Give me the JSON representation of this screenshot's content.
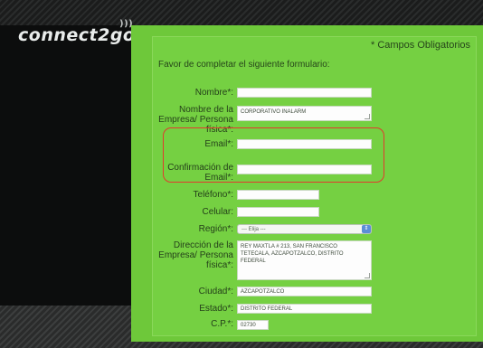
{
  "brand": {
    "logo": "connect2go"
  },
  "form": {
    "required_note": "* Campos Obligatorios",
    "intro": "Favor de completar el siguiente formulario:",
    "nombre_label": "Nombre*:",
    "nombre_value": "",
    "empresa_label": "Nombre de la Empresa/ Persona física*:",
    "empresa_value": "CORPORATIVO INALARM",
    "email_label": "Email*:",
    "email_value": "",
    "confirm_label": "Confirmación de Email*:",
    "confirm_value": "",
    "telefono_label": "Teléfono*:",
    "telefono_value": "",
    "celular_label": "Celular:",
    "celular_value": "",
    "region_label": "Región*:",
    "region_value": "--- Elija ---",
    "direccion_label": "Dirección de la Empresa/ Persona física*:",
    "direccion_value": "REY MAXTLA # 213, SAN FRANCISCO TETECALA, AZCAPOTZALCO, DISTRITO FEDERAL",
    "ciudad_label": "Ciudad*:",
    "ciudad_value": "AZCAPOTZALCO",
    "estado_label": "Estado*:",
    "estado_value": "DISTRITO FEDERAL",
    "cp_label": "C.P.*:",
    "cp_value": "02730"
  },
  "colors": {
    "panel": "#6ec83a",
    "highlight": "#e23a2e",
    "background": "#0c0d0d"
  }
}
